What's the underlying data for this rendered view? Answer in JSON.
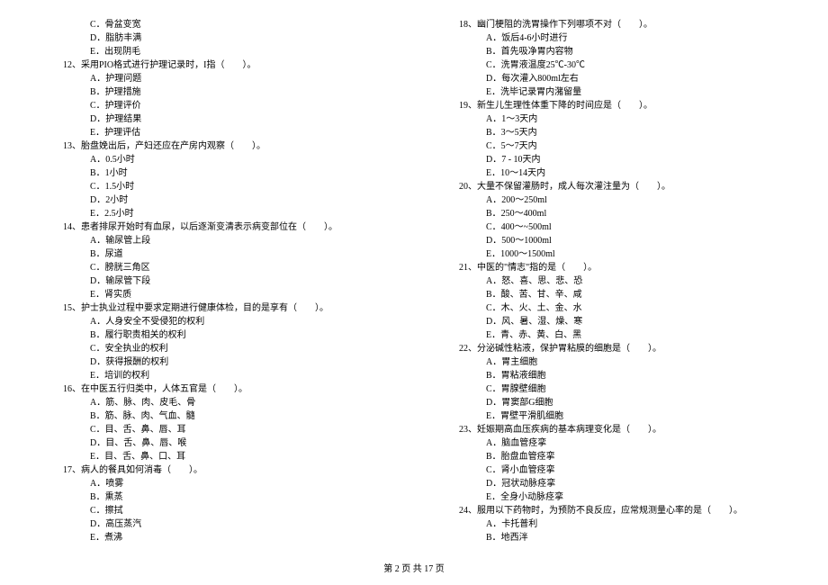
{
  "left": {
    "q11_options": {
      "c": "C．骨盆变宽",
      "d": "D．脂肪丰满",
      "e": "E．出现阴毛"
    },
    "q12": {
      "text": "12、采用PIO格式进行护理记录时，I指（　　）。",
      "a": "A．护理问题",
      "b": "B．护理措施",
      "c": "C．护理评价",
      "d": "D．护理结果",
      "e": "E．护理评估"
    },
    "q13": {
      "text": "13、胎盘娩出后，产妇还应在产房内观察（　　）。",
      "a": "A．0.5小时",
      "b": "B．1小时",
      "c": "C．1.5小时",
      "d": "D．2小时",
      "e": "E．2.5小时"
    },
    "q14": {
      "text": "14、患者排尿开始时有血尿，以后逐渐变清表示病变部位在（　　）。",
      "a": "A．输尿管上段",
      "b": "B．尿道",
      "c": "C．膀胱三角区",
      "d": "D．输尿管下段",
      "e": "E．肾实质"
    },
    "q15": {
      "text": "15、护士执业过程中要求定期进行健康体检，目的是享有（　　）。",
      "a": "A．人身安全不受侵犯的权利",
      "b": "B．履行职责相关的权利",
      "c": "C．安全执业的权利",
      "d": "D．获得报酬的权利",
      "e": "E．培训的权利"
    },
    "q16": {
      "text": "16、在中医五行归类中，人体五官是（　　）。",
      "a": "A．筋、脉、肉、皮毛、骨",
      "b": "B．筋、脉、肉、气血、髓",
      "c": "C．目、舌、鼻、唇、耳",
      "d": "D．目、舌、鼻、唇、喉",
      "e": "E．目、舌、鼻、口、耳"
    },
    "q17": {
      "text": "17、病人的餐具如何消毒（　　）。",
      "a": "A．喷雾",
      "b": "B．熏蒸",
      "c": "C．擦拭",
      "d": "D．高压蒸汽",
      "e": "E．煮沸"
    }
  },
  "right": {
    "q18": {
      "text": "18、幽门梗阻的洗胃操作下列哪项不对（　　）。",
      "a": "A．饭后4-6小时进行",
      "b": "B．首先吸净胃内容物",
      "c": "C．洗胃液温度25℃-30℃",
      "d": "D．每次灌入800ml左右",
      "e": "E．洗毕记录胃内潴留量"
    },
    "q19": {
      "text": "19、新生儿生理性体重下降的时间应是（　　）。",
      "a": "A．1～3天内",
      "b": "B．3～5天内",
      "c": "C．5～7天内",
      "d": "D．7 - 10天内",
      "e": "E．10～14天内"
    },
    "q20": {
      "text": "20、大量不保留灌肠时，成人每次灌注量为（　　）。",
      "a": "A．200～250ml",
      "b": "B．250～400ml",
      "c": "C．400～~500ml",
      "d": "D．500～1000ml",
      "e": "E．1000～1500ml"
    },
    "q21": {
      "text": "21、中医的\"情志\"指的是（　　）。",
      "a": "A．怒、喜、思、悲、恐",
      "b": "B．酸、苦、甘、辛、咸",
      "c": "C．木、火、土、金、水",
      "d": "D．风、暑、湿、燥、寒",
      "e": "E．青、赤、黄、白、黑"
    },
    "q22": {
      "text": "22、分泌碱性粘液，保护胃粘膜的细胞是（　　）。",
      "a": "A．胃主细胞",
      "b": "B．胃粘液细胞",
      "c": "C．胃腺壁细胞",
      "d": "D．胃窦部G细胞",
      "e": "E．胃壁平滑肌细胞"
    },
    "q23": {
      "text": "23、妊娠期高血压疾病的基本病理变化是（　　）。",
      "a": "A．脑血管痉挛",
      "b": "B．胎盘血管痉挛",
      "c": "C．肾小血管痉挛",
      "d": "D．冠状动脉痉挛",
      "e": "E．全身小动脉痉挛"
    },
    "q24": {
      "text": "24、服用以下药物时，为预防不良反应，应常规测量心率的是（　　）。",
      "a": "A．卡托普利",
      "b": "B．地西泮"
    }
  },
  "footer": "第 2 页 共 17 页"
}
